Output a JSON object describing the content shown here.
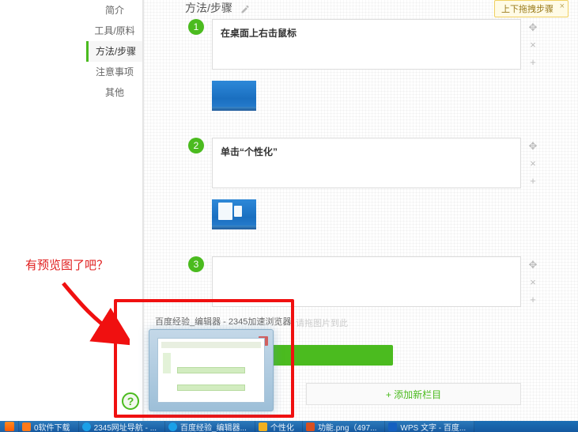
{
  "sidebar": {
    "items": [
      {
        "label": "简介"
      },
      {
        "label": "工具/原料"
      },
      {
        "label": "方法/步骤"
      },
      {
        "label": "注意事项"
      },
      {
        "label": "其他"
      }
    ],
    "active_index": 2
  },
  "section": {
    "title": "方法/步骤"
  },
  "tooltip": {
    "text": "上下拖拽步骤",
    "close": "×"
  },
  "steps": [
    {
      "num": "1",
      "text": "在桌面上右击鼠标"
    },
    {
      "num": "2",
      "text": "单击“个性化”"
    },
    {
      "num": "3",
      "text": ""
    }
  ],
  "handles": {
    "move": "✥",
    "remove": "×",
    "add": "+"
  },
  "add_section": {
    "plus": "+",
    "label": "添加新栏目"
  },
  "hidden_helper": "请拖图片到此",
  "annotation": {
    "text": "有预览图了吧？",
    "preview_title": "百度经验_编辑器 - 2345加速浏览器",
    "help": "?"
  },
  "taskbar": {
    "pinned": [
      {
        "name": "start",
        "color1": "#ff6a00",
        "color2": "#ffb030"
      }
    ],
    "items": [
      {
        "name": "downloads",
        "label": "0软件下载",
        "color": "#ff7a1a"
      },
      {
        "name": "2345nav",
        "label": "2345网址导航 - ...",
        "color": "#1aa0e8"
      },
      {
        "name": "browser",
        "label": "百度经验_编辑器...",
        "color": "#1aa0e8"
      },
      {
        "name": "personalize",
        "label": "个性化",
        "color": "#f0b020"
      },
      {
        "name": "image",
        "label": "功能.png（497...",
        "color": "#d85020"
      },
      {
        "name": "wps",
        "label": "WPS 文字 - 百度...",
        "color": "#1560c0"
      }
    ]
  }
}
